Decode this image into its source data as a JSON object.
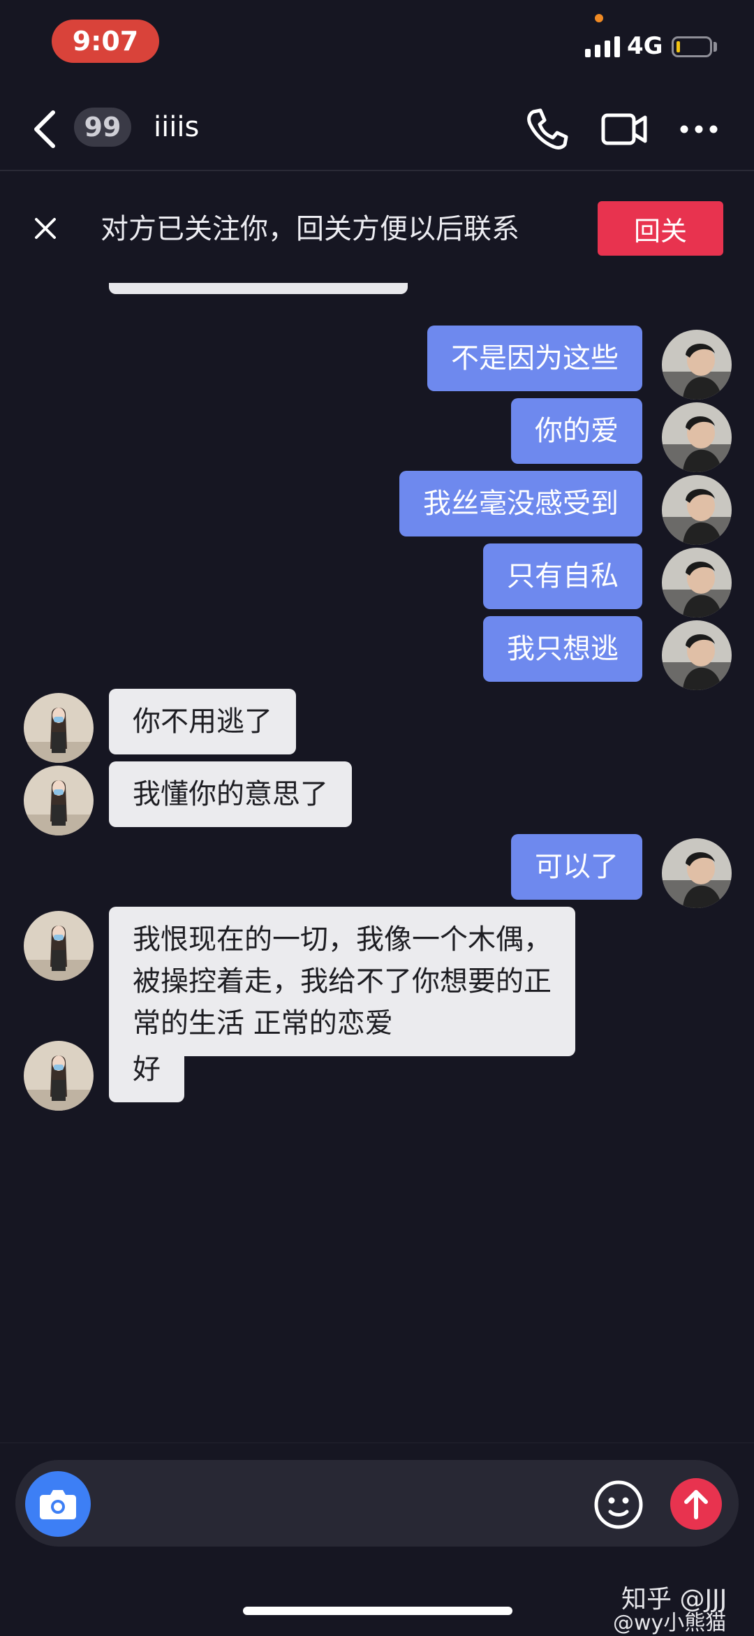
{
  "status_bar": {
    "time": "9:07",
    "network": "4G",
    "battery_level": 0.1
  },
  "header": {
    "unread_count": "99",
    "contact_name": "iiiis"
  },
  "banner": {
    "text": "对方已关注你，回关方便以后联系",
    "follow_back_label": "回关"
  },
  "messages": [
    {
      "sender": "me",
      "text": "不是因为这些"
    },
    {
      "sender": "me",
      "text": "你的爱"
    },
    {
      "sender": "me",
      "text": "我丝毫没感受到"
    },
    {
      "sender": "me",
      "text": "只有自私"
    },
    {
      "sender": "me",
      "text": "我只想逃"
    },
    {
      "sender": "other",
      "text": "你不用逃了"
    },
    {
      "sender": "other",
      "text": "我懂你的意思了"
    },
    {
      "sender": "me",
      "text": "可以了"
    },
    {
      "sender": "other",
      "text": "我恨现在的一切，我像一个木偶，\n被操控着走，我给不了你想要的正\n常的生活 正常的恋爱"
    },
    {
      "sender": "other",
      "text": "好"
    }
  ],
  "input": {
    "placeholder": ""
  },
  "watermark": {
    "line1": "知乎 @JJJ",
    "line2": "@wy小熊猫"
  },
  "colors": {
    "my_bubble": "#6e89ee",
    "their_bubble": "#ebebee",
    "accent": "#e8334f",
    "background": "#161622"
  }
}
